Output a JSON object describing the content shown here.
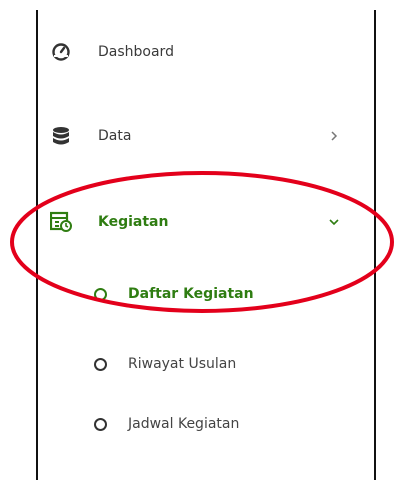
{
  "menu": {
    "dashboard": {
      "label": "Dashboard",
      "icon": "gauge-icon"
    },
    "data": {
      "label": "Data",
      "icon": "database-icon",
      "chevron": "chevron-right-icon"
    },
    "kegiatan": {
      "label": "Kegiatan",
      "icon": "calendar-list-icon",
      "chevron": "chevron-down-icon",
      "expanded": true
    },
    "submenu": [
      {
        "label": "Daftar Kegiatan",
        "active": true
      },
      {
        "label": "Riwayat Usulan",
        "active": false
      },
      {
        "label": "Jadwal Kegiatan",
        "active": false
      }
    ]
  },
  "colors": {
    "accent": "#2f7d12",
    "annotation": "#e3001b",
    "text": "#3a3a3a"
  }
}
